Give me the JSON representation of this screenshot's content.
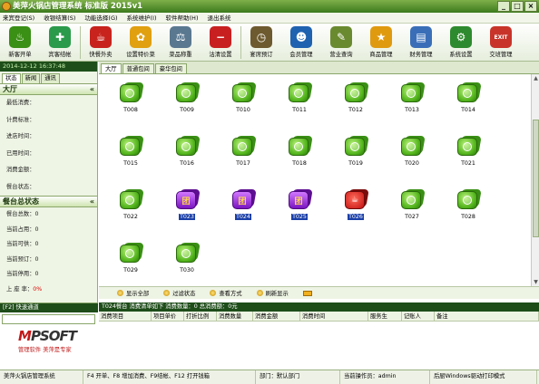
{
  "app": {
    "title": "美萍火锅店管理系统  标准版   2015v1",
    "min": "_",
    "max": "□",
    "close": "×"
  },
  "menu": [
    "来宾登记(S)",
    "收银结算(S)",
    "功能选择(G)",
    "系统维护(I)",
    "软件帮助(H)",
    "退出系统"
  ],
  "toolbar": [
    {
      "label": "新客开单",
      "icon": "new-customer-icon",
      "color": "#3a8f15",
      "glyph": "♨"
    },
    {
      "label": "宾客结帐",
      "icon": "checkout-icon",
      "color": "#2b9a4a",
      "glyph": "✚"
    },
    {
      "label": "快餐外卖",
      "icon": "takeout-icon",
      "color": "#c8231d",
      "glyph": "☕"
    },
    {
      "label": "设置特价菜",
      "icon": "special-dish-icon",
      "color": "#e0a010",
      "glyph": "✿"
    },
    {
      "label": "菜品称重",
      "icon": "weigh-icon",
      "color": "#5a7890",
      "glyph": "⚖"
    },
    {
      "label": "沽清设置",
      "icon": "sold-out-icon",
      "color": "#c82020",
      "glyph": "−"
    },
    {
      "label": "宴席预订",
      "icon": "reservation-icon",
      "color": "#6d5a2e",
      "glyph": "◷"
    },
    {
      "label": "会员管理",
      "icon": "member-icon",
      "color": "#1f62b0",
      "glyph": "☻"
    },
    {
      "label": "营业查询",
      "icon": "query-icon",
      "color": "#6a8a30",
      "glyph": "✎"
    },
    {
      "label": "商品管理",
      "icon": "goods-icon",
      "color": "#e09a10",
      "glyph": "★"
    },
    {
      "label": "财务管理",
      "icon": "finance-icon",
      "color": "#3a6fb8",
      "glyph": "▤"
    },
    {
      "label": "系统设置",
      "icon": "settings-icon",
      "color": "#2e8a2e",
      "glyph": "⚙"
    },
    {
      "label": "交班管理",
      "icon": "shift-icon",
      "color": "#c8342a",
      "glyph": "EXIT"
    }
  ],
  "left": {
    "datetime": "2014-12-12 16:37:48",
    "tabs": [
      "状态",
      "新闻",
      "通讯"
    ],
    "hall_title": "大厅",
    "hall_fields": [
      "最低消费：",
      "计费标准：",
      "进店时间：",
      "已用时间：",
      "消费金额：",
      "餐台状态："
    ],
    "summary_title": "餐台总状态",
    "summary_fields": [
      {
        "label": "餐台总数：",
        "value": "0"
      },
      {
        "label": "当前占用：",
        "value": "0"
      },
      {
        "label": "当前可供：",
        "value": "0"
      },
      {
        "label": "当前预订：",
        "value": "0"
      },
      {
        "label": "当前停用：",
        "value": "0"
      },
      {
        "label": "上  座  率：",
        "value": "0%"
      }
    ],
    "quick_title": "[F2] 快速通道",
    "logo_m": "M",
    "logo_rest": "PSOFT",
    "slogan": "管理软件 美萍是专家"
  },
  "main": {
    "tabs": [
      "大厅",
      "普通包间",
      "豪华包间"
    ],
    "tables": [
      {
        "id": "T008",
        "state": "green"
      },
      {
        "id": "T009",
        "state": "green"
      },
      {
        "id": "T010",
        "state": "green"
      },
      {
        "id": "T011",
        "state": "green"
      },
      {
        "id": "T012",
        "state": "green"
      },
      {
        "id": "T013",
        "state": "green"
      },
      {
        "id": "T014",
        "state": "green"
      },
      {
        "id": "T015",
        "state": "green"
      },
      {
        "id": "T016",
        "state": "green"
      },
      {
        "id": "T017",
        "state": "green"
      },
      {
        "id": "T018",
        "state": "green"
      },
      {
        "id": "T019",
        "state": "green"
      },
      {
        "id": "T020",
        "state": "green"
      },
      {
        "id": "T021",
        "state": "green"
      },
      {
        "id": "T022",
        "state": "green"
      },
      {
        "id": "T023",
        "state": "purple"
      },
      {
        "id": "T024",
        "state": "purple"
      },
      {
        "id": "T025",
        "state": "purple"
      },
      {
        "id": "T026",
        "state": "red"
      },
      {
        "id": "T027",
        "state": "green"
      },
      {
        "id": "T028",
        "state": "green"
      },
      {
        "id": "T029",
        "state": "green"
      },
      {
        "id": "T030",
        "state": "green"
      }
    ],
    "reserved_glyph": "团",
    "occupied_glyph": "☕",
    "actions": [
      "显示全部",
      "过滤状态",
      "查看方式",
      "刷新显示"
    ]
  },
  "order": {
    "title": "T024餐台   消费清单如下  消费数量：0  总消费额：0元",
    "columns": [
      "消费项目",
      "项目单价",
      "打折比例",
      "消费数量",
      "消费金额",
      "消费时间",
      "服务生",
      "记账人",
      "备注"
    ]
  },
  "status": [
    "美萍火锅店管理系统",
    "F4 开单、F8 增加消费、F9结帐、F12 打开钱箱",
    "部门：默认部门",
    "当前操作员：admin",
    "后厨Windows驱动打印模式"
  ]
}
